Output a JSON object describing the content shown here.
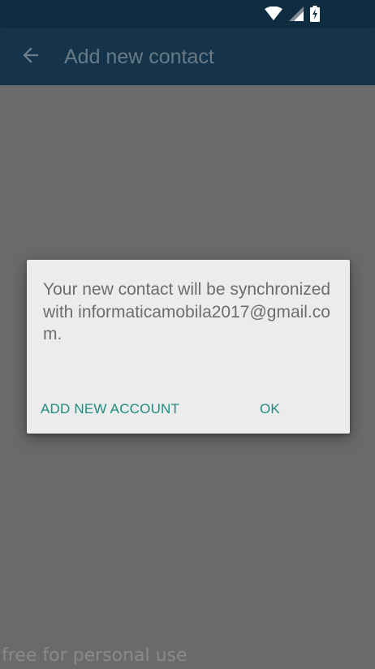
{
  "status_bar": {
    "icons": [
      "wifi-icon",
      "cellular-signal-icon",
      "battery-charging-icon"
    ]
  },
  "app_bar": {
    "title": "Add new contact",
    "back_icon": "arrow-back-icon",
    "background": "#15344b",
    "title_color": "#697a87"
  },
  "dialog": {
    "message": "Your new contact will be synchronized with informaticamobila2017@gmail.com.",
    "actions": {
      "secondary": "ADD NEW ACCOUNT",
      "primary": "OK"
    },
    "accent_color": "#1e8c82"
  },
  "watermark": "free for personal use"
}
